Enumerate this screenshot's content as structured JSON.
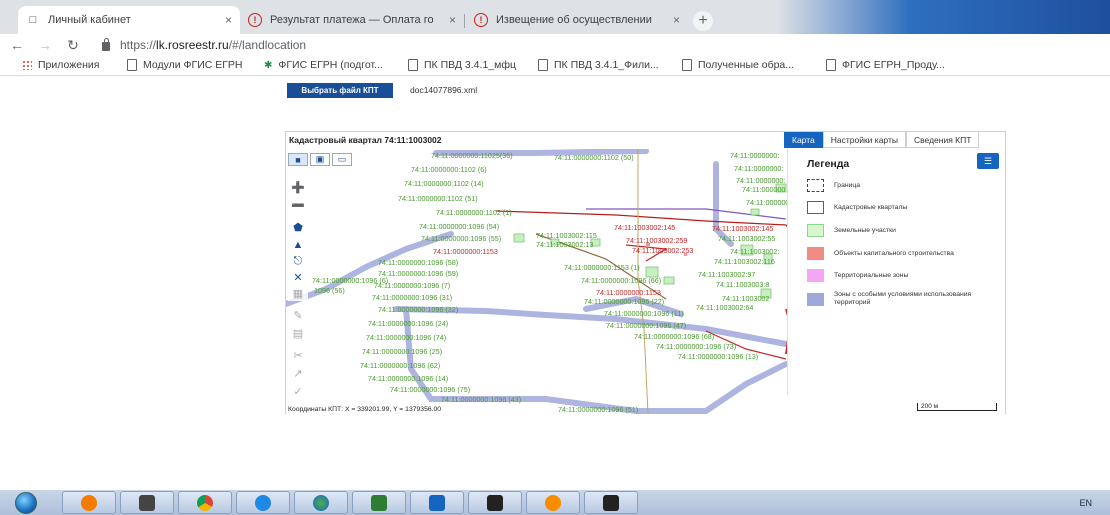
{
  "browser": {
    "tabs": [
      {
        "title": "Личный кабинет",
        "icon": "page-icon",
        "active": true
      },
      {
        "title": "Результат платежа — Оплата го",
        "icon": "error-icon",
        "active": false
      },
      {
        "title": "Извещение об осуществлении",
        "icon": "error-icon",
        "active": false
      }
    ],
    "close_glyph": "×",
    "new_tab_glyph": "+",
    "url_scheme": "https://",
    "url_host": "lk.rosreestr.ru",
    "url_path": "/#/landlocation",
    "bookmarks": [
      {
        "label": "Приложения",
        "icon": "apps-icon"
      },
      {
        "label": "Модули ФГИС ЕГРН",
        "icon": "page-icon"
      },
      {
        "label": "ФГИС ЕГРН (подгот...",
        "icon": "star-icon"
      },
      {
        "label": "ПК ПВД 3.4.1_мфц",
        "icon": "page-icon"
      },
      {
        "label": "ПК ПВД 3.4.1_Фили...",
        "icon": "page-icon"
      },
      {
        "label": "Полученные обра...",
        "icon": "page-icon"
      },
      {
        "label": "ФГИС ЕГРН_Проду...",
        "icon": "page-icon"
      }
    ]
  },
  "page": {
    "pick_file_label": "Выбрать файл КПТ",
    "file_name": "doc14077896.xml",
    "panel_title": "Кадастровый квартал 74:11:1003002",
    "tabs": [
      "Карта",
      "Настройки карты",
      "Сведения КПТ"
    ],
    "active_tab": "Карта",
    "coordinates": "Координаты КПТ: X = 339201.99, Y = 1379356.00",
    "scale": "200 м",
    "legend": {
      "title": "Легенда",
      "items": [
        {
          "label": "Граница",
          "color": "#444444",
          "style": "dashed"
        },
        {
          "label": "Кадастровые кварталы",
          "color": "#d32f2f",
          "style": "outline"
        },
        {
          "label": "Земельные участки",
          "color": "#9be59b",
          "style": "fill-outline"
        },
        {
          "label": "Объекты капитального строительства",
          "color": "#f28b82",
          "style": "fill"
        },
        {
          "label": "Территориальные зоны",
          "color": "#f3a6f3",
          "style": "fill"
        },
        {
          "label": "Зоны с особыми условиями использования территорий",
          "color": "#9fa8da",
          "style": "fill"
        }
      ]
    },
    "map_labels": [
      {
        "text": "74:11:0000000:11025(36)",
        "c": "g"
      },
      {
        "text": "74:11:0000000:1102 (50)",
        "c": "g"
      },
      {
        "text": "74:11:0000000:1102 (6)",
        "c": "g"
      },
      {
        "text": "74:11:0000000:1102 (14)",
        "c": "g"
      },
      {
        "text": "74:11:0000000:1102 (51)",
        "c": "g"
      },
      {
        "text": "74:11:0000000:1102 (1)",
        "c": "g"
      },
      {
        "text": "74:11:0000000:1096 (54)",
        "c": "g"
      },
      {
        "text": "74:11:0000000:1096 (55)",
        "c": "g"
      },
      {
        "text": "74:11:0000000:1153",
        "c": "r"
      },
      {
        "text": "74:11:0000000:1096 (58)",
        "c": "g"
      },
      {
        "text": "74:11:0000000:1096 (59)",
        "c": "g"
      },
      {
        "text": "74:11:0000000:1096 (7)",
        "c": "g"
      },
      {
        "text": "74:11:0000000:1096 (31)",
        "c": "g"
      },
      {
        "text": "74:11:0000000:1096 (32)",
        "c": "g"
      },
      {
        "text": "74:11:0000000:1096 (24)",
        "c": "g"
      },
      {
        "text": "74:11:0000000:1096 (74)",
        "c": "g"
      },
      {
        "text": "74:11:0000000:1096 (25)",
        "c": "g"
      },
      {
        "text": "74:11:0000000:1096 (62)",
        "c": "g"
      },
      {
        "text": "74:11:0000000:1096 (14)",
        "c": "g"
      },
      {
        "text": "74:11:0000000:1096 (75)",
        "c": "g"
      },
      {
        "text": "74:11:0000000:1096 (43)",
        "c": "g"
      },
      {
        "text": "74:11:0000000:1096 (51)",
        "c": "g"
      },
      {
        "text": "74:11:0000000:1096 (6)",
        "c": "g"
      },
      {
        "text": "1096 (56)",
        "c": "g"
      },
      {
        "text": "74:11:1003002:115",
        "c": "g"
      },
      {
        "text": "74:11:1003002:13",
        "c": "g"
      },
      {
        "text": "74:11:1003002:145",
        "c": "r"
      },
      {
        "text": "74:11:1003002:259",
        "c": "r"
      },
      {
        "text": "74:11:1003002:253",
        "c": "r"
      },
      {
        "text": "74:11:0000000:1153 (1)",
        "c": "g"
      },
      {
        "text": "74:11:0000000:1096 (66)",
        "c": "g"
      },
      {
        "text": "74:11:0000000:1153",
        "c": "r"
      },
      {
        "text": "74:11:0000000:1096 (22)",
        "c": "g"
      },
      {
        "text": "74:11:0000000:1096 (11)",
        "c": "g"
      },
      {
        "text": "74:11:0000000:1096 (47)",
        "c": "g"
      },
      {
        "text": "74:11:0000000:1096 (68)",
        "c": "g"
      },
      {
        "text": "74:11:0000000:1096 (73)",
        "c": "g"
      },
      {
        "text": "74:11:0000000:1096 (13)",
        "c": "g"
      },
      {
        "text": "74:11:1003002:145",
        "c": "r"
      },
      {
        "text": "74:11:1003002:55",
        "c": "g"
      },
      {
        "text": "74:11:1003002:116",
        "c": "g"
      },
      {
        "text": "74:11:1003002:97",
        "c": "g"
      },
      {
        "text": "74:11:1003003:8",
        "c": "g"
      },
      {
        "text": "74:11:1003002:64",
        "c": "g"
      },
      {
        "text": "74:11:0000000:",
        "c": "g"
      },
      {
        "text": "74:11:0000000:",
        "c": "g"
      },
      {
        "text": "74:11:0000000:",
        "c": "g"
      },
      {
        "text": "74:11:000000",
        "c": "g"
      },
      {
        "text": "74:11:0000000",
        "c": "g"
      },
      {
        "text": "74:11:1003002:",
        "c": "g"
      },
      {
        "text": "74:11:1003002",
        "c": "g"
      }
    ]
  },
  "taskbar": {
    "apps": [
      "explorer",
      "media-player",
      "paint",
      "chrome",
      "internet-explorer",
      "globe",
      "excel",
      "word",
      "viewer",
      "cartoon",
      "viewer-2"
    ],
    "language": "EN"
  }
}
